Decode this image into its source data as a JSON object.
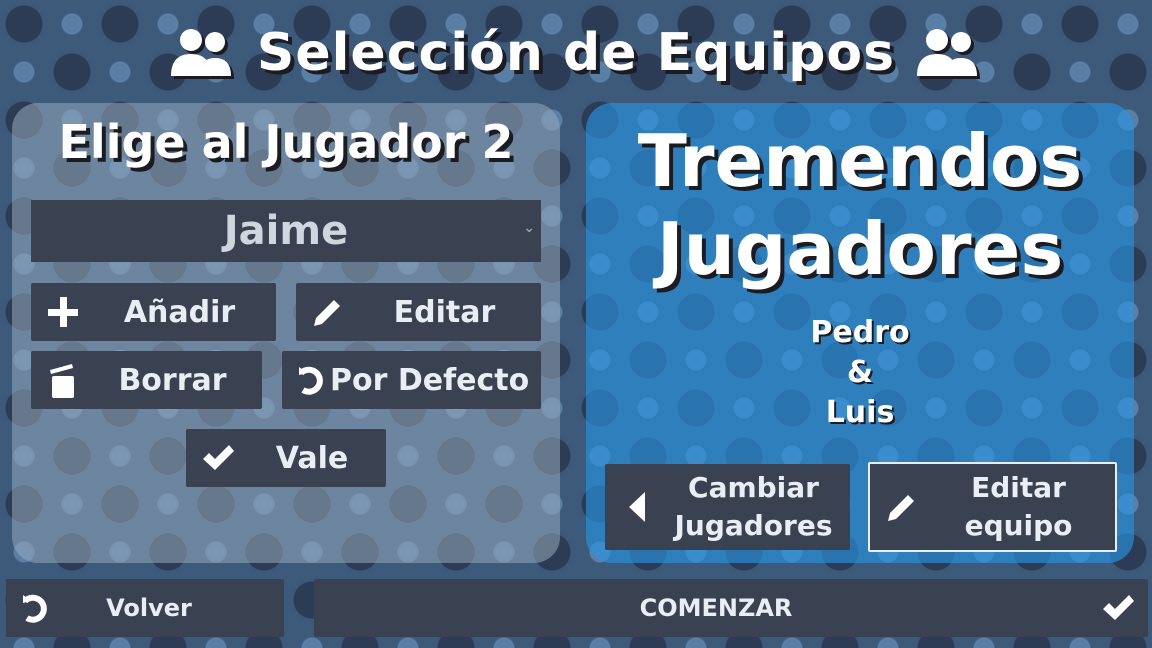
{
  "header": {
    "title": "Selección de Equipos"
  },
  "player_panel": {
    "heading": "Elige al Jugador 2",
    "selected_player": "Jaime",
    "buttons": {
      "add": "Añadir",
      "edit": "Editar",
      "delete": "Borrar",
      "default": "Por Defecto",
      "ok": "Vale"
    }
  },
  "team_panel": {
    "name_line1": "Tremendos",
    "name_line2": "Jugadores",
    "member1": "Pedro",
    "joiner": "&",
    "member2": "Luis",
    "change_players_line1": "Cambiar",
    "change_players_line2": "Jugadores",
    "edit_team_line1": "Editar",
    "edit_team_line2": "equipo"
  },
  "footer": {
    "back": "Volver",
    "start": "COMENZAR"
  },
  "icons": [
    "people-icon",
    "plus-icon",
    "pencil-icon",
    "trash-icon",
    "undo-icon",
    "check-icon",
    "arrow-left-icon",
    "chevron-down-icon"
  ],
  "colors": {
    "accent_blue": "#2896e6",
    "button_bg": "#3a4150",
    "panel_grey": "#96aabe"
  }
}
